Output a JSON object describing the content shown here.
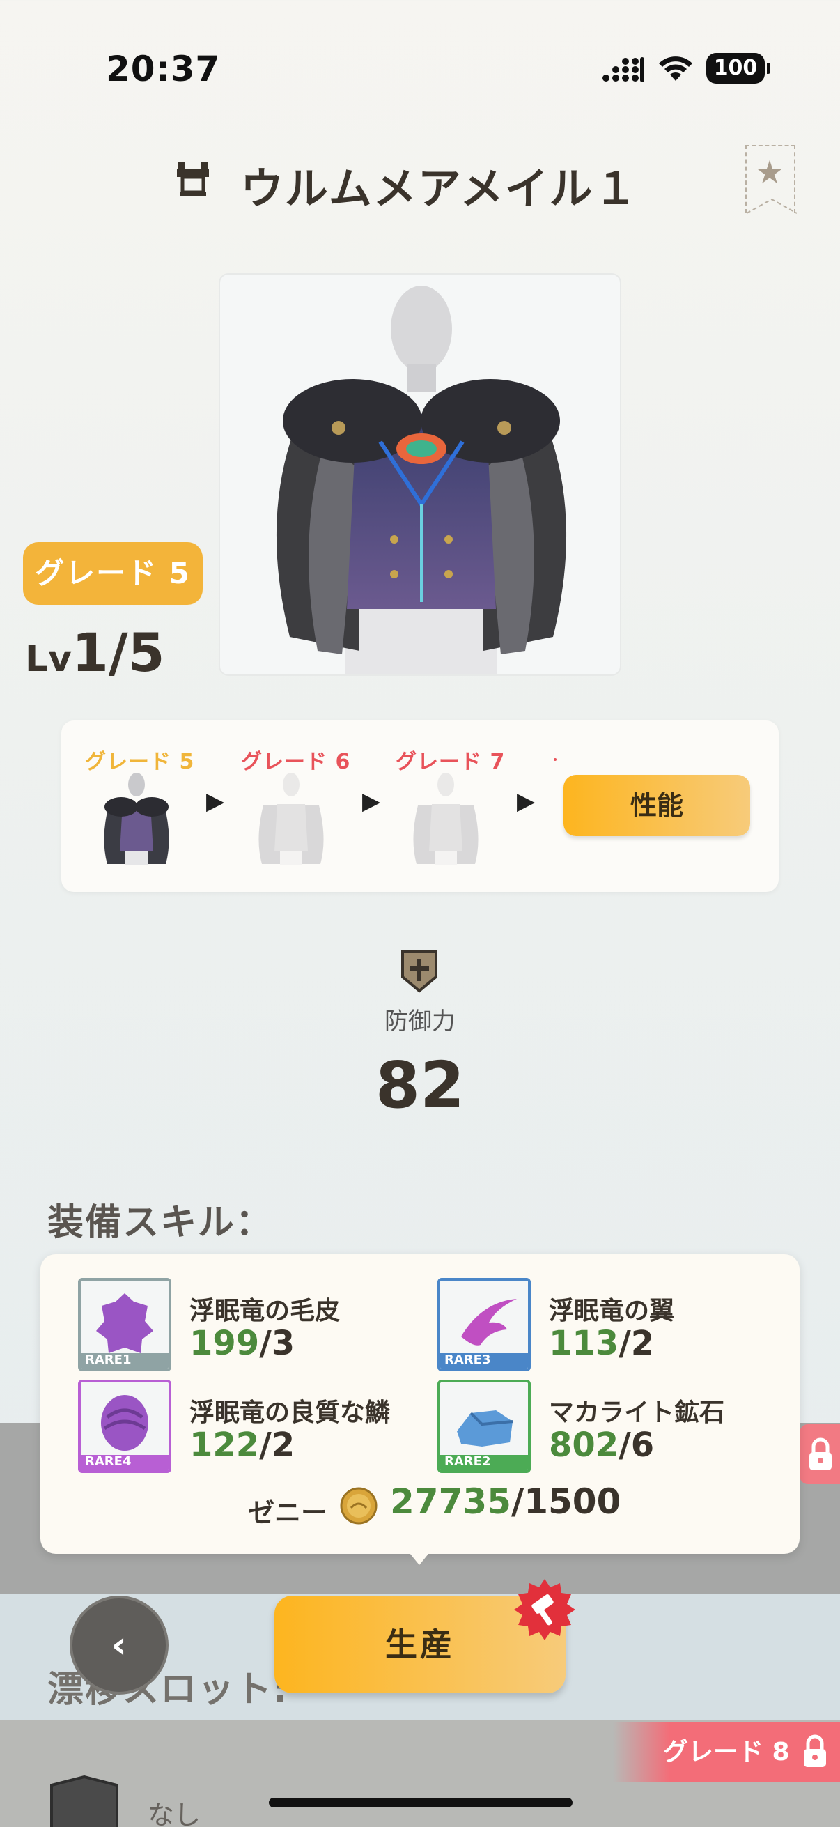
{
  "status_bar": {
    "time": "20:37",
    "battery": "100"
  },
  "header": {
    "title": "ウルムメアメイル１",
    "armor_icon": "armor-icon",
    "bookmark_icon": "star-bookmark-icon"
  },
  "equipment": {
    "grade_badge": "グレード 5",
    "level_prefix": "Lv",
    "level": "1/5"
  },
  "grade_panel": {
    "stages": [
      {
        "label": "グレード 5",
        "color": "#f0b53a",
        "active": true
      },
      {
        "label": "グレード 6",
        "color": "#e8535a",
        "active": false
      },
      {
        "label": "グレード 7",
        "color": "#e8535a",
        "active": false
      }
    ],
    "performance_button": "性能"
  },
  "defense": {
    "label": "防御力",
    "value": "82"
  },
  "skills": {
    "header": "装備スキル："
  },
  "materials": {
    "items": [
      {
        "name": "浮眠竜の毛皮",
        "have": "199",
        "need": "/3",
        "rarity": "RARE1",
        "color": "#8fa3a4"
      },
      {
        "name": "浮眠竜の翼",
        "have": "113",
        "need": "/2",
        "rarity": "RARE3",
        "color": "#4a86c8"
      },
      {
        "name": "浮眠竜の良質な鱗",
        "have": "122",
        "need": "/2",
        "rarity": "RARE4",
        "color": "#b85fd4"
      },
      {
        "name": "マカライト鉱石",
        "have": "802",
        "need": "/6",
        "rarity": "RARE2",
        "color": "#4cab55"
      }
    ],
    "zeny_label": "ゼニー",
    "zeny_have": "27735",
    "zeny_need": "/1500"
  },
  "actions": {
    "produce": "生産",
    "back_icon": "chevron-left-icon"
  },
  "drift_slot": {
    "label": "漂移スロット:",
    "value": "なし",
    "lock_grade": "グレード 8"
  }
}
